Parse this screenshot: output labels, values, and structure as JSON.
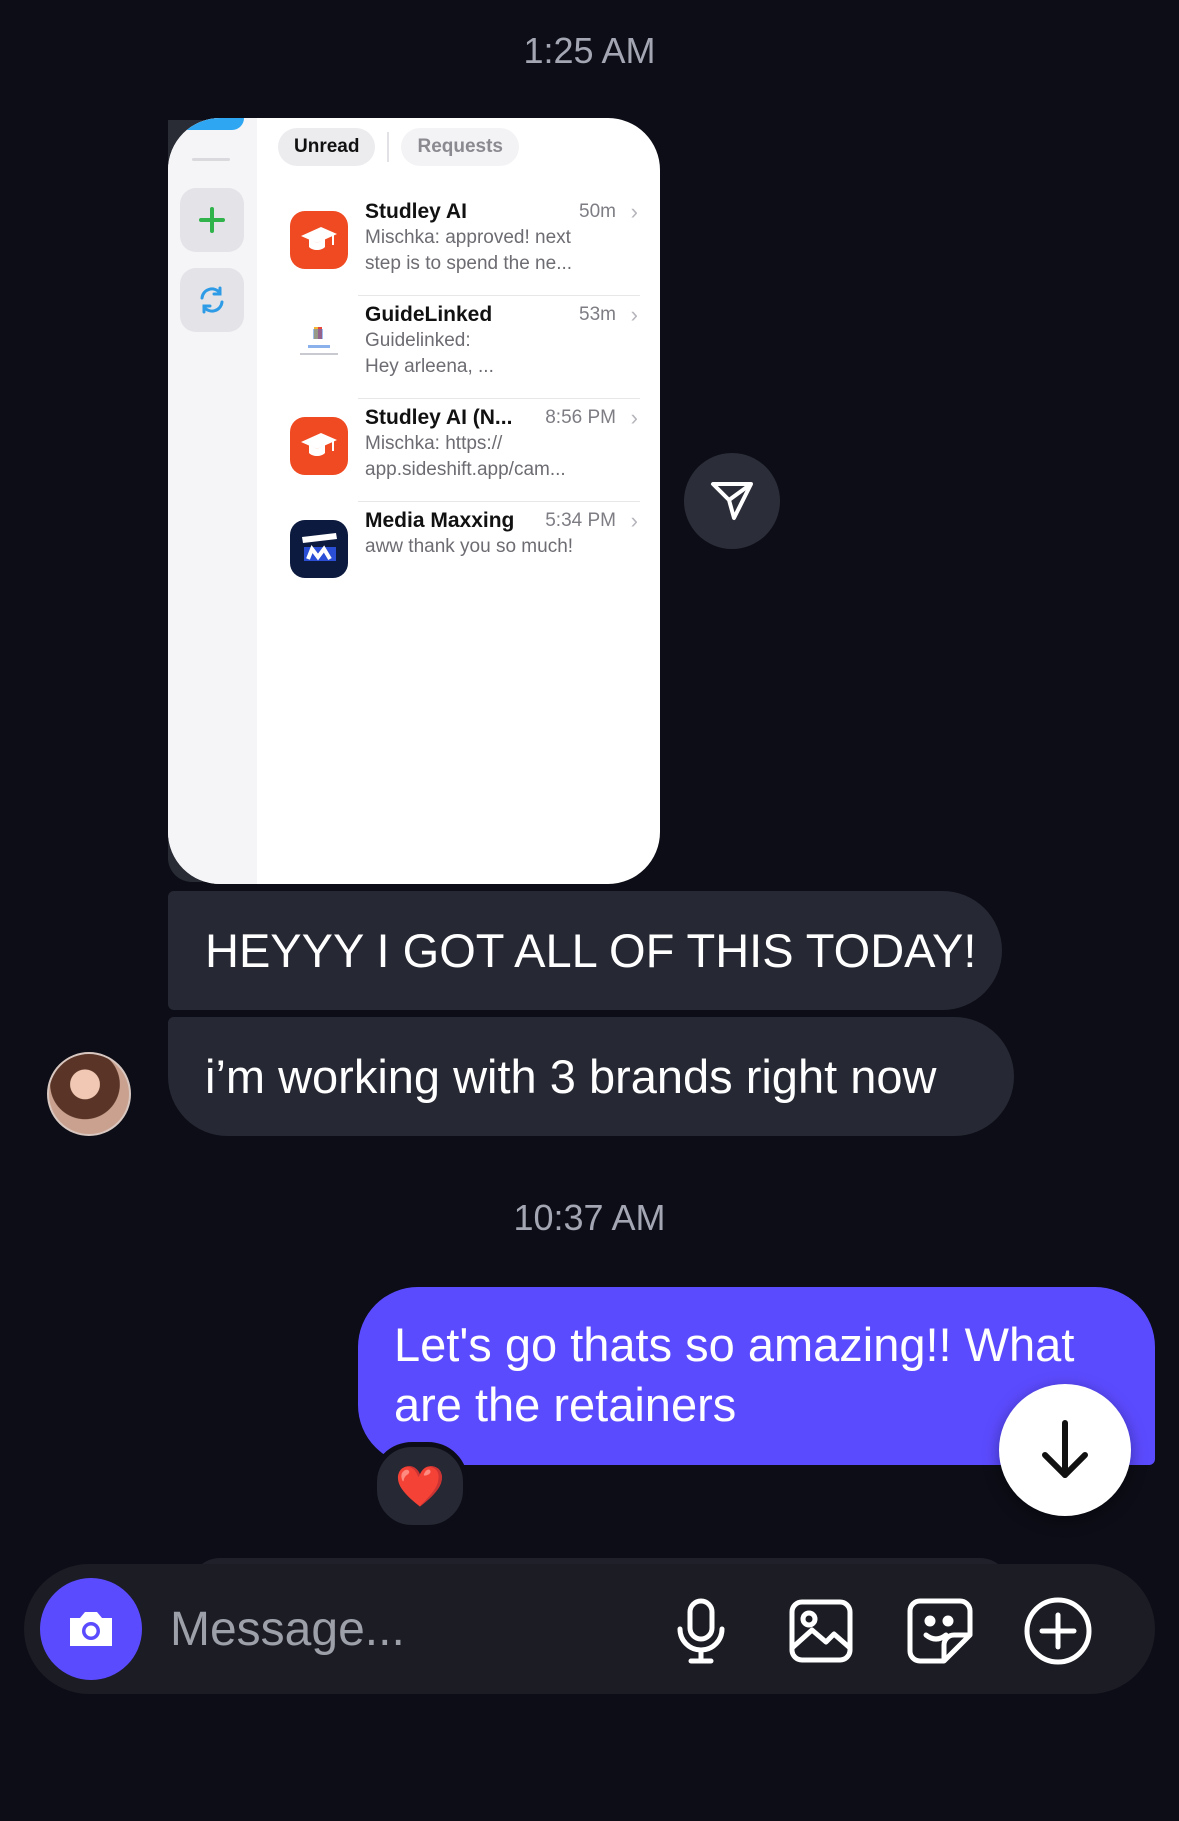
{
  "thread": {
    "timestamp_1": "1:25 AM",
    "timestamp_2": "10:37 AM"
  },
  "shared_screenshot": {
    "tabs": [
      "Unread",
      "Requests"
    ],
    "conversations": [
      {
        "name": "Studley AI",
        "time": "50m",
        "line1": "Mischka: approved! next",
        "line2": "step is to spend the ne...",
        "icon": "graduation-cap-icon"
      },
      {
        "name": "GuideLinked",
        "time": "53m",
        "line1": "Guidelinked:",
        "line2": "Hey arleena, ...",
        "icon": "guidelinked-logo"
      },
      {
        "name": "Studley AI (N...",
        "time": "8:56 PM",
        "line1": "Mischka: https://",
        "line2": "app.sideshift.app/cam...",
        "icon": "graduation-cap-icon"
      },
      {
        "name": "Media Maxxing",
        "time": "5:34 PM",
        "line1": "aww thank you so much!",
        "line2": "",
        "icon": "media-maxxing-logo"
      }
    ]
  },
  "messages": {
    "incoming_1": "HEYYY I GOT ALL OF THIS TODAY!",
    "incoming_2": "i’m working with 3 brands right now",
    "outgoing_line1": "Let's go thats so amazing!! What",
    "outgoing_line2": "are the retainers",
    "reaction": "❤️"
  },
  "composer": {
    "placeholder": "Message..."
  },
  "colors": {
    "background": "#0c0d16",
    "incoming_bubble": "#262833",
    "outgoing_bubble": "#5b4bff",
    "accent": "#5b4bff"
  }
}
